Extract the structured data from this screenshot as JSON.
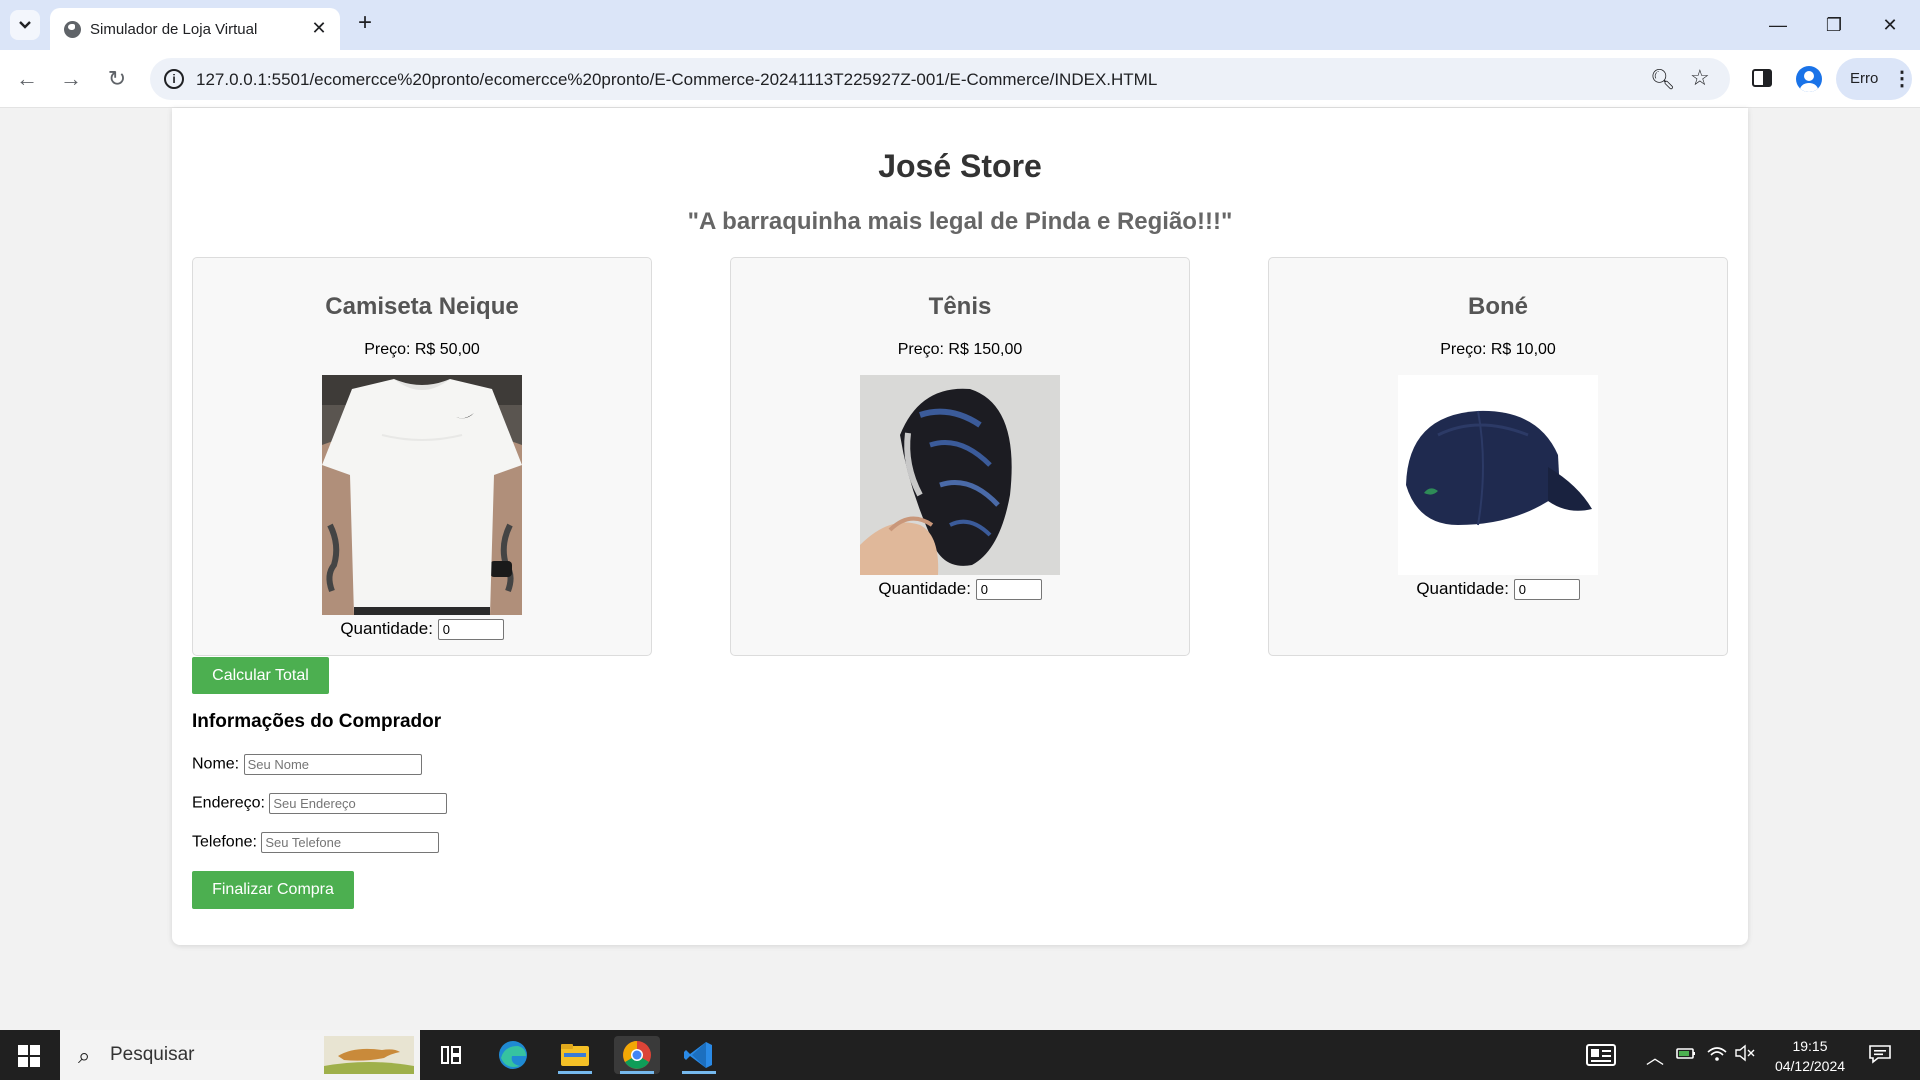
{
  "browser": {
    "tab_title": "Simulador de Loja Virtual",
    "url": "127.0.0.1:5501/ecomercce%20pronto/ecomercce%20pronto/E-Commerce-20241113T225927Z-001/E-Commerce/INDEX.HTML",
    "profile_label": "Erro"
  },
  "store": {
    "title": "José Store",
    "slogan": "\"A barraquinha mais legal de Pinda e Região!!!\""
  },
  "products": [
    {
      "name": "Camiseta Neique",
      "price": "Preço: R$ 50,00",
      "qty_label": "Quantidade:",
      "qty_value": "0",
      "image": "white-tshirt-image"
    },
    {
      "name": "Tênis",
      "price": "Preço: R$ 150,00",
      "qty_label": "Quantidade:",
      "qty_value": "0",
      "image": "black-sneaker-image"
    },
    {
      "name": "Boné",
      "price": "Preço: R$ 10,00",
      "qty_label": "Quantidade:",
      "qty_value": "0",
      "image": "navy-cap-image"
    }
  ],
  "actions": {
    "calc_total": "Calcular Total",
    "finalize": "Finalizar Compra"
  },
  "buyer": {
    "title": "Informações do Comprador",
    "name_label": "Nome:",
    "name_placeholder": "Seu Nome",
    "address_label": "Endereço:",
    "address_placeholder": "Seu Endereço",
    "phone_label": "Telefone:",
    "phone_placeholder": "Seu Telefone"
  },
  "taskbar": {
    "search_placeholder": "Pesquisar",
    "time": "19:15",
    "date": "04/12/2024"
  },
  "colors": {
    "button_green": "#4caf50",
    "tabbar_bg": "#dbe5f8",
    "taskbar_bg": "#202020"
  }
}
